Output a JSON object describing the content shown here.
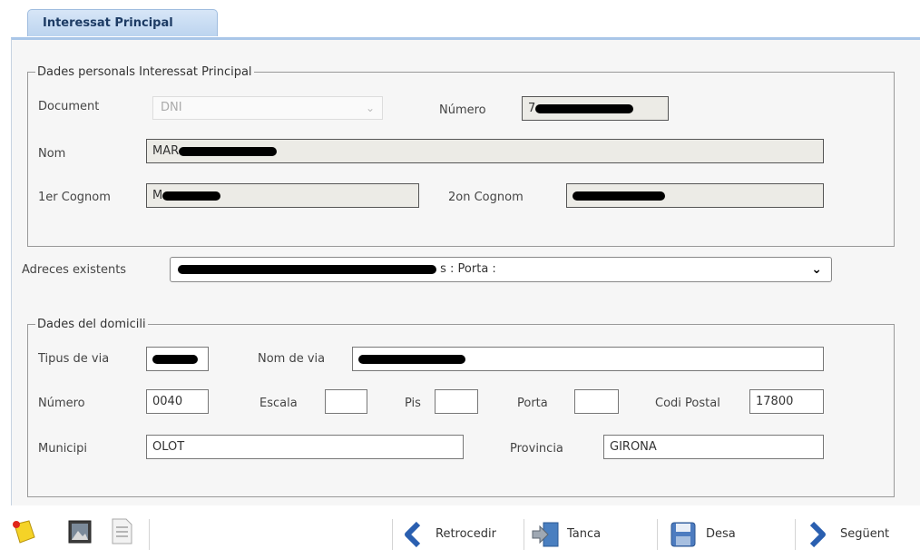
{
  "tab": {
    "label": "Interessat Principal"
  },
  "personal": {
    "legend": "Dades personals Interessat Principal",
    "document_label": "Document",
    "document_value": "DNI",
    "numero_label": "Número",
    "numero_value": "7",
    "nom_label": "Nom",
    "nom_value": "MAR",
    "cognom1_label": "1er Cognom",
    "cognom1_value": "M",
    "cognom2_label": "2on Cognom",
    "cognom2_value": ""
  },
  "adreces": {
    "label": "Adreces existents",
    "value": "s : Porta :"
  },
  "domicili": {
    "legend": "Dades del domicili",
    "tipus_via_label": "Tipus de via",
    "tipus_via_value": "",
    "nom_via_label": "Nom de via",
    "nom_via_value": "",
    "numero_label": "Número",
    "numero_value": "0040",
    "escala_label": "Escala",
    "escala_value": "",
    "pis_label": "Pis",
    "pis_value": "",
    "porta_label": "Porta",
    "porta_value": "",
    "cp_label": "Codi Postal",
    "cp_value": "17800",
    "municipi_label": "Municipi",
    "municipi_value": "OLOT",
    "provincia_label": "Provincia",
    "provincia_value": "GIRONA"
  },
  "toolbar": {
    "icons": [
      "new-document-icon",
      "image-icon",
      "report-icon"
    ],
    "retrocedir": "Retrocedir",
    "tanca": "Tanca",
    "desa": "Desa",
    "seguent": "Següent"
  },
  "colors": {
    "tab_bg": "#c9dcf2",
    "panel_border": "#a9c6e8",
    "readonly_bg": "#ecebe6",
    "nav_arrow": "#2a5fb0"
  }
}
